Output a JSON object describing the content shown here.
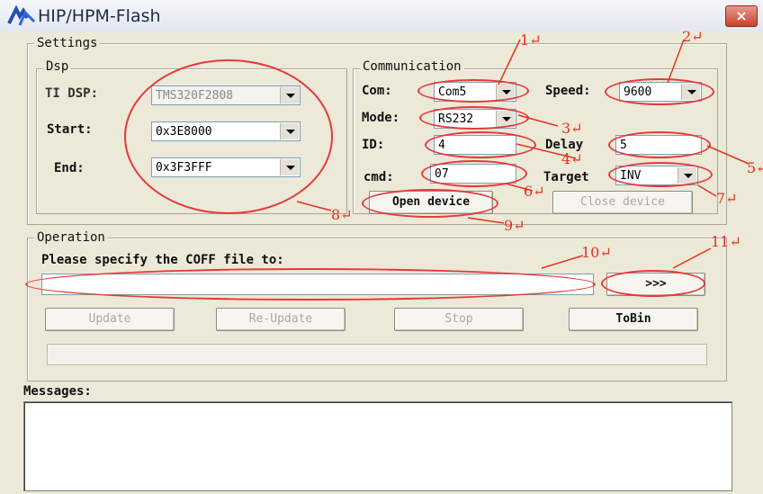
{
  "window": {
    "title": "HIP/HPM-Flash",
    "close_symbol": "×"
  },
  "settings": {
    "legend": "Settings",
    "dsp": {
      "legend": "Dsp",
      "ti_dsp_label": "TI DSP:",
      "ti_dsp_value": "TMS320F2808",
      "start_label": "Start:",
      "start_value": "0x3E8000",
      "end_label": "End:",
      "end_value": "0x3F3FFF"
    },
    "communication": {
      "legend": "Communication",
      "com_label": "Com:",
      "com_value": "Com5",
      "speed_label": "Speed:",
      "speed_value": "9600",
      "mode_label": "Mode:",
      "mode_value": "RS232",
      "id_label": "ID:",
      "id_value": "4",
      "delay_label": "Delay",
      "delay_value": "5",
      "cmd_label": "cmd:",
      "cmd_value": "07",
      "target_label": "Target",
      "target_value": "INV",
      "open_button": "Open device",
      "close_button": "Close device"
    }
  },
  "operation": {
    "legend": "Operation",
    "prompt": "Please specify the COFF file to:",
    "file_path": "",
    "browse_button": ">>>",
    "update_button": "Update",
    "reupdate_button": "Re-Update",
    "stop_button": "Stop",
    "tobin_button": "ToBin",
    "progress": 0
  },
  "messages": {
    "label": "Messages:",
    "content": ""
  },
  "annotations": {
    "n1": "1↵",
    "n2": "2↵",
    "n3": "3↵",
    "n4": "4↵",
    "n5": "5↵",
    "n6": "6↵",
    "n7": "7↵",
    "n8": "8↵",
    "n9": "9↵",
    "n10": "10↵",
    "n11": "11↵",
    "color": "#e5331f"
  }
}
